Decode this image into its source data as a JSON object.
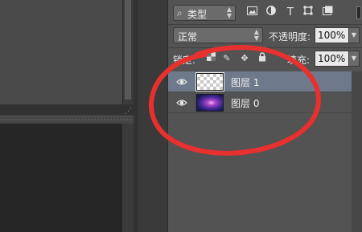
{
  "filter": {
    "kind_label": "类型",
    "icons": [
      "image-filter-icon",
      "adjustment-filter-icon",
      "type-filter-icon",
      "shape-filter-icon",
      "smart-object-filter-icon"
    ]
  },
  "blend": {
    "mode": "正常",
    "opacity_label": "不透明度:",
    "opacity_value": "100%"
  },
  "lock": {
    "label": "锁定:",
    "fill_label": "填充:",
    "fill_value": "100%"
  },
  "layers": [
    {
      "name": "图层 1",
      "selected": true,
      "visible": true,
      "thumbnail": "transparent"
    },
    {
      "name": "图层 0",
      "selected": false,
      "visible": true,
      "thumbnail": "galaxy"
    }
  ],
  "annotation": {
    "color": "#e8302e"
  },
  "colors": {
    "panel": "#535353",
    "selection": "#6e7a8c"
  }
}
